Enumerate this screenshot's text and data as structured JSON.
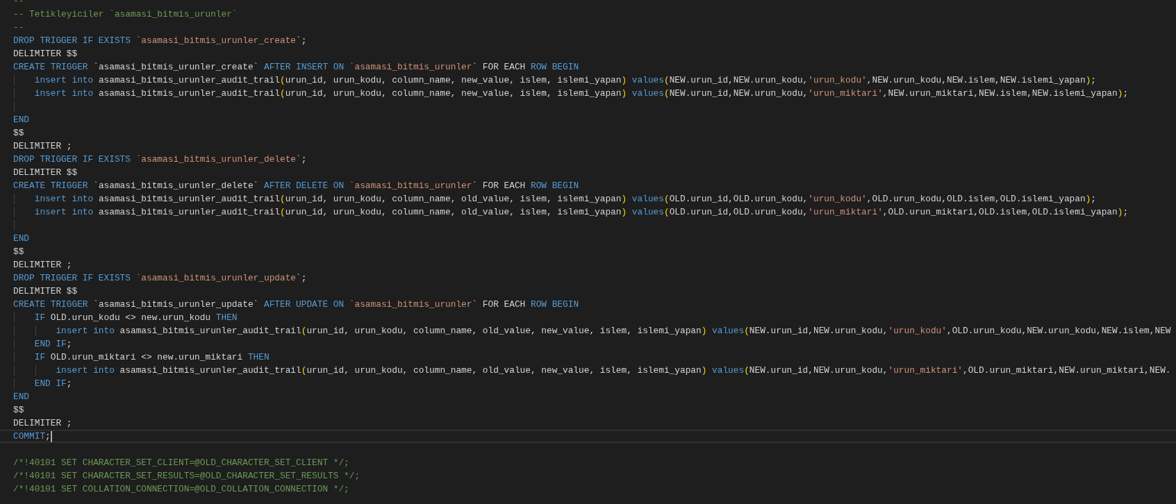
{
  "editor": {
    "lines": [
      {
        "current_line": false,
        "tokens": [
          {
            "kind": "comment",
            "text": "--"
          }
        ]
      },
      {
        "current_line": false,
        "tokens": [
          {
            "kind": "comment",
            "text": "-- Tetikleyiciler `asamasi_bitmis_urunler`"
          }
        ]
      },
      {
        "current_line": false,
        "tokens": [
          {
            "kind": "comment",
            "text": "--"
          }
        ]
      },
      {
        "current_line": false,
        "tokens": [
          {
            "kind": "keyword",
            "text": "DROP TRIGGER IF EXISTS "
          },
          {
            "kind": "string",
            "text": "`asamasi_bitmis_urunler_create"
          },
          {
            "kind": "plain",
            "text": "`;"
          }
        ]
      },
      {
        "current_line": false,
        "tokens": [
          {
            "kind": "plain",
            "text": "DELIMITER $$"
          }
        ]
      },
      {
        "current_line": false,
        "tokens": [
          {
            "kind": "keyword",
            "text": "CREATE TRIGGER "
          },
          {
            "kind": "plain",
            "text": "`asamasi_bitmis_urunler_create` "
          },
          {
            "kind": "keyword",
            "text": "AFTER INSERT ON "
          },
          {
            "kind": "string",
            "text": "`asamasi_bitmis_urunler"
          },
          {
            "kind": "plain",
            "text": "` FOR EACH "
          },
          {
            "kind": "keyword",
            "text": "ROW BEGIN"
          }
        ]
      },
      {
        "current_line": false,
        "tokens": [
          {
            "kind": "keyword",
            "text": "    insert into "
          },
          {
            "kind": "plain",
            "text": "asamasi_bitmis_urunler_audit_trail"
          },
          {
            "kind": "bracket",
            "text": "("
          },
          {
            "kind": "plain",
            "text": "urun_id, urun_kodu, column_name, new_value, islem, islemi_yapan"
          },
          {
            "kind": "bracket",
            "text": ")"
          },
          {
            "kind": "keyword",
            "text": " values"
          },
          {
            "kind": "bracket",
            "text": "("
          },
          {
            "kind": "plain",
            "text": "NEW.urun_id,NEW.urun_kodu,"
          },
          {
            "kind": "string",
            "text": "'urun_kodu'"
          },
          {
            "kind": "plain",
            "text": ",NEW.urun_kodu,NEW.islem,NEW.islemi_yapan"
          },
          {
            "kind": "bracket",
            "text": ")"
          },
          {
            "kind": "plain",
            "text": ";"
          }
        ]
      },
      {
        "current_line": false,
        "tokens": [
          {
            "kind": "keyword",
            "text": "    insert into "
          },
          {
            "kind": "plain",
            "text": "asamasi_bitmis_urunler_audit_trail"
          },
          {
            "kind": "bracket",
            "text": "("
          },
          {
            "kind": "plain",
            "text": "urun_id, urun_kodu, column_name, new_value, islem, islemi_yapan"
          },
          {
            "kind": "bracket",
            "text": ")"
          },
          {
            "kind": "keyword",
            "text": " values"
          },
          {
            "kind": "bracket",
            "text": "("
          },
          {
            "kind": "plain",
            "text": "NEW.urun_id,NEW.urun_kodu,"
          },
          {
            "kind": "string",
            "text": "'urun_miktari'"
          },
          {
            "kind": "plain",
            "text": ",NEW.urun_miktari,NEW.islem,NEW.islemi_yapan"
          },
          {
            "kind": "bracket",
            "text": ")"
          },
          {
            "kind": "plain",
            "text": ";"
          }
        ]
      },
      {
        "current_line": false
      },
      {
        "current_line": false,
        "tokens": [
          {
            "kind": "keyword",
            "text": "END"
          }
        ]
      },
      {
        "current_line": false,
        "tokens": [
          {
            "kind": "plain",
            "text": "$$"
          }
        ]
      },
      {
        "current_line": false,
        "tokens": [
          {
            "kind": "plain",
            "text": "DELIMITER ;"
          }
        ]
      },
      {
        "current_line": false,
        "tokens": [
          {
            "kind": "keyword",
            "text": "DROP TRIGGER IF EXISTS "
          },
          {
            "kind": "string",
            "text": "`asamasi_bitmis_urunler_delete"
          },
          {
            "kind": "plain",
            "text": "`;"
          }
        ]
      },
      {
        "current_line": false,
        "tokens": [
          {
            "kind": "plain",
            "text": "DELIMITER $$"
          }
        ]
      },
      {
        "current_line": false,
        "tokens": [
          {
            "kind": "keyword",
            "text": "CREATE TRIGGER "
          },
          {
            "kind": "plain",
            "text": "`asamasi_bitmis_urunler_delete` "
          },
          {
            "kind": "keyword",
            "text": "AFTER DELETE ON "
          },
          {
            "kind": "string",
            "text": "`asamasi_bitmis_urunler"
          },
          {
            "kind": "plain",
            "text": "` FOR EACH "
          },
          {
            "kind": "keyword",
            "text": "ROW BEGIN"
          }
        ]
      },
      {
        "current_line": false,
        "tokens": [
          {
            "kind": "keyword",
            "text": "    insert into "
          },
          {
            "kind": "plain",
            "text": "asamasi_bitmis_urunler_audit_trail"
          },
          {
            "kind": "bracket",
            "text": "("
          },
          {
            "kind": "plain",
            "text": "urun_id, urun_kodu, column_name, old_value, islem, islemi_yapan"
          },
          {
            "kind": "bracket",
            "text": ")"
          },
          {
            "kind": "keyword",
            "text": " values"
          },
          {
            "kind": "bracket",
            "text": "("
          },
          {
            "kind": "plain",
            "text": "OLD.urun_id,OLD.urun_kodu,"
          },
          {
            "kind": "string",
            "text": "'urun_kodu'"
          },
          {
            "kind": "plain",
            "text": ",OLD.urun_kodu,OLD.islem,OLD.islemi_yapan"
          },
          {
            "kind": "bracket",
            "text": ")"
          },
          {
            "kind": "plain",
            "text": ";"
          }
        ]
      },
      {
        "current_line": false,
        "tokens": [
          {
            "kind": "keyword",
            "text": "    insert into "
          },
          {
            "kind": "plain",
            "text": "asamasi_bitmis_urunler_audit_trail"
          },
          {
            "kind": "bracket",
            "text": "("
          },
          {
            "kind": "plain",
            "text": "urun_id, urun_kodu, column_name, old_value, islem, islemi_yapan"
          },
          {
            "kind": "bracket",
            "text": ")"
          },
          {
            "kind": "keyword",
            "text": " values"
          },
          {
            "kind": "bracket",
            "text": "("
          },
          {
            "kind": "plain",
            "text": "OLD.urun_id,OLD.urun_kodu,"
          },
          {
            "kind": "string",
            "text": "'urun_miktari'"
          },
          {
            "kind": "plain",
            "text": ",OLD.urun_miktari,OLD.islem,OLD.islemi_yapan"
          },
          {
            "kind": "bracket",
            "text": ")"
          },
          {
            "kind": "plain",
            "text": ";"
          }
        ]
      },
      {
        "current_line": false
      },
      {
        "current_line": false,
        "tokens": [
          {
            "kind": "keyword",
            "text": "END"
          }
        ]
      },
      {
        "current_line": false,
        "tokens": [
          {
            "kind": "plain",
            "text": "$$"
          }
        ]
      },
      {
        "current_line": false,
        "tokens": [
          {
            "kind": "plain",
            "text": "DELIMITER ;"
          }
        ]
      },
      {
        "current_line": false,
        "tokens": [
          {
            "kind": "keyword",
            "text": "DROP TRIGGER IF EXISTS "
          },
          {
            "kind": "string",
            "text": "`asamasi_bitmis_urunler_update"
          },
          {
            "kind": "plain",
            "text": "`;"
          }
        ]
      },
      {
        "current_line": false,
        "tokens": [
          {
            "kind": "plain",
            "text": "DELIMITER $$"
          }
        ]
      },
      {
        "current_line": false,
        "tokens": [
          {
            "kind": "keyword",
            "text": "CREATE TRIGGER "
          },
          {
            "kind": "plain",
            "text": "`asamasi_bitmis_urunler_update` "
          },
          {
            "kind": "keyword",
            "text": "AFTER UPDATE ON "
          },
          {
            "kind": "string",
            "text": "`asamasi_bitmis_urunler"
          },
          {
            "kind": "plain",
            "text": "` FOR EACH "
          },
          {
            "kind": "keyword",
            "text": "ROW BEGIN"
          }
        ]
      },
      {
        "current_line": false,
        "tokens": [
          {
            "kind": "keyword",
            "text": "    IF"
          },
          {
            "kind": "plain",
            "text": " OLD.urun_kodu <> new.urun_kodu "
          },
          {
            "kind": "keyword",
            "text": "THEN"
          }
        ]
      },
      {
        "current_line": false,
        "tokens": [
          {
            "kind": "keyword",
            "text": "        insert into "
          },
          {
            "kind": "plain",
            "text": "asamasi_bitmis_urunler_audit_trail"
          },
          {
            "kind": "bracket",
            "text": "("
          },
          {
            "kind": "plain",
            "text": "urun_id, urun_kodu, column_name, old_value, new_value, islem, islemi_yapan"
          },
          {
            "kind": "bracket",
            "text": ")"
          },
          {
            "kind": "keyword",
            "text": " values"
          },
          {
            "kind": "bracket",
            "text": "("
          },
          {
            "kind": "plain",
            "text": "NEW.urun_id,NEW.urun_kodu,"
          },
          {
            "kind": "string",
            "text": "'urun_kodu'"
          },
          {
            "kind": "plain",
            "text": ",OLD.urun_kodu,NEW.urun_kodu,NEW.islem,NEW"
          }
        ]
      },
      {
        "current_line": false,
        "tokens": [
          {
            "kind": "keyword",
            "text": "    END IF"
          },
          {
            "kind": "plain",
            "text": ";"
          }
        ]
      },
      {
        "current_line": false,
        "tokens": [
          {
            "kind": "keyword",
            "text": "    IF"
          },
          {
            "kind": "plain",
            "text": " OLD.urun_miktari <> new.urun_miktari "
          },
          {
            "kind": "keyword",
            "text": "THEN"
          }
        ]
      },
      {
        "current_line": false,
        "tokens": [
          {
            "kind": "keyword",
            "text": "        insert into "
          },
          {
            "kind": "plain",
            "text": "asamasi_bitmis_urunler_audit_trail"
          },
          {
            "kind": "bracket",
            "text": "("
          },
          {
            "kind": "plain",
            "text": "urun_id, urun_kodu, column_name, old_value, new_value, islem, islemi_yapan"
          },
          {
            "kind": "bracket",
            "text": ")"
          },
          {
            "kind": "keyword",
            "text": " values"
          },
          {
            "kind": "bracket",
            "text": "("
          },
          {
            "kind": "plain",
            "text": "NEW.urun_id,NEW.urun_kodu,"
          },
          {
            "kind": "string",
            "text": "'urun_miktari'"
          },
          {
            "kind": "plain",
            "text": ",OLD.urun_miktari,NEW.urun_miktari,NEW."
          }
        ]
      },
      {
        "current_line": false,
        "tokens": [
          {
            "kind": "keyword",
            "text": "    END IF"
          },
          {
            "kind": "plain",
            "text": ";"
          }
        ]
      },
      {
        "current_line": false,
        "tokens": [
          {
            "kind": "keyword",
            "text": "END"
          }
        ]
      },
      {
        "current_line": false,
        "tokens": [
          {
            "kind": "plain",
            "text": "$$"
          }
        ]
      },
      {
        "current_line": false,
        "tokens": [
          {
            "kind": "plain",
            "text": "DELIMITER ;"
          }
        ]
      },
      {
        "current_line": true,
        "tokens": [
          {
            "kind": "keyword",
            "text": "COMMIT"
          },
          {
            "kind": "plain",
            "text": ";"
          }
        ]
      },
      {
        "current_line": false
      },
      {
        "current_line": false,
        "tokens": [
          {
            "kind": "comment",
            "text": "/*!40101 SET CHARACTER_SET_CLIENT=@OLD_CHARACTER_SET_CLIENT */;"
          }
        ]
      },
      {
        "current_line": false,
        "tokens": [
          {
            "kind": "comment",
            "text": "/*!40101 SET CHARACTER_SET_RESULTS=@OLD_CHARACTER_SET_RESULTS */;"
          }
        ]
      },
      {
        "current_line": false,
        "tokens": [
          {
            "kind": "comment",
            "text": "/*!40101 SET COLLATION_CONNECTION=@OLD_COLLATION_CONNECTION */;"
          }
        ]
      }
    ]
  }
}
